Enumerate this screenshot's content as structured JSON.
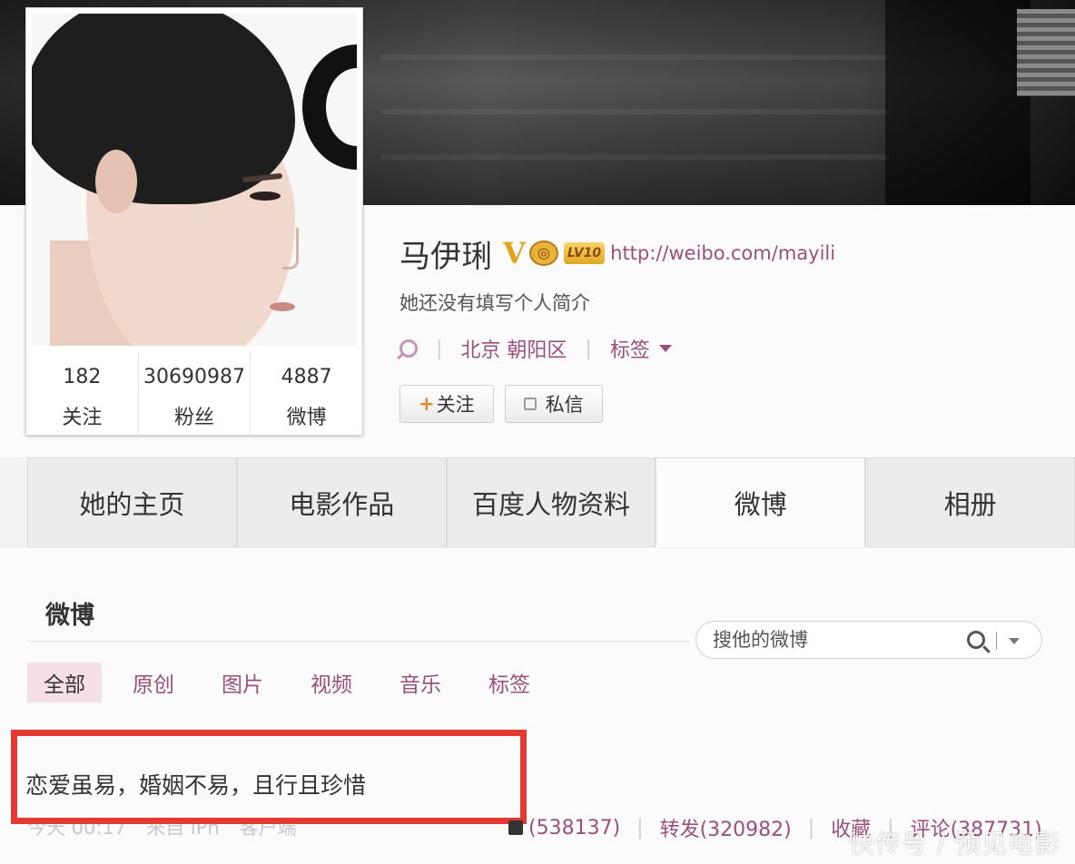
{
  "profile": {
    "name": "马伊琍",
    "level": "LV10",
    "url": "http://weibo.com/mayili",
    "intro": "她还没有填写个人简介",
    "location": "北京 朝阳区",
    "tags_label": "标签",
    "follow_label": "关注",
    "message_label": "私信"
  },
  "stats": [
    {
      "value": "182",
      "label": "关注"
    },
    {
      "value": "30690987",
      "label": "粉丝"
    },
    {
      "value": "4887",
      "label": "微博"
    }
  ],
  "tabs": [
    {
      "label": "她的主页",
      "active": false
    },
    {
      "label": "电影作品",
      "active": false
    },
    {
      "label": "百度人物资料",
      "active": false
    },
    {
      "label": "微博",
      "active": true
    },
    {
      "label": "相册",
      "active": false
    }
  ],
  "feed": {
    "title": "微博",
    "search_placeholder": "搜他的微博",
    "filters": [
      {
        "label": "全部",
        "active": true
      },
      {
        "label": "原创",
        "active": false
      },
      {
        "label": "图片",
        "active": false
      },
      {
        "label": "视频",
        "active": false
      },
      {
        "label": "音乐",
        "active": false
      },
      {
        "label": "标签",
        "active": false
      }
    ]
  },
  "post": {
    "text": "恋爱虽易，婚姻不易，且行且珍惜",
    "meta_time": "今天 00:17",
    "meta_source": "来自 iPh",
    "meta_extra": "客户端",
    "likes": "(538137)",
    "repost": "转发(320982)",
    "favorite": "收藏",
    "comment": "评论(387731)"
  },
  "watermark": "快传号 / 预见电影",
  "colors": {
    "link": "#9b4f7a",
    "highlight": "#e53935",
    "active_filter_bg": "#f7dfe6"
  }
}
